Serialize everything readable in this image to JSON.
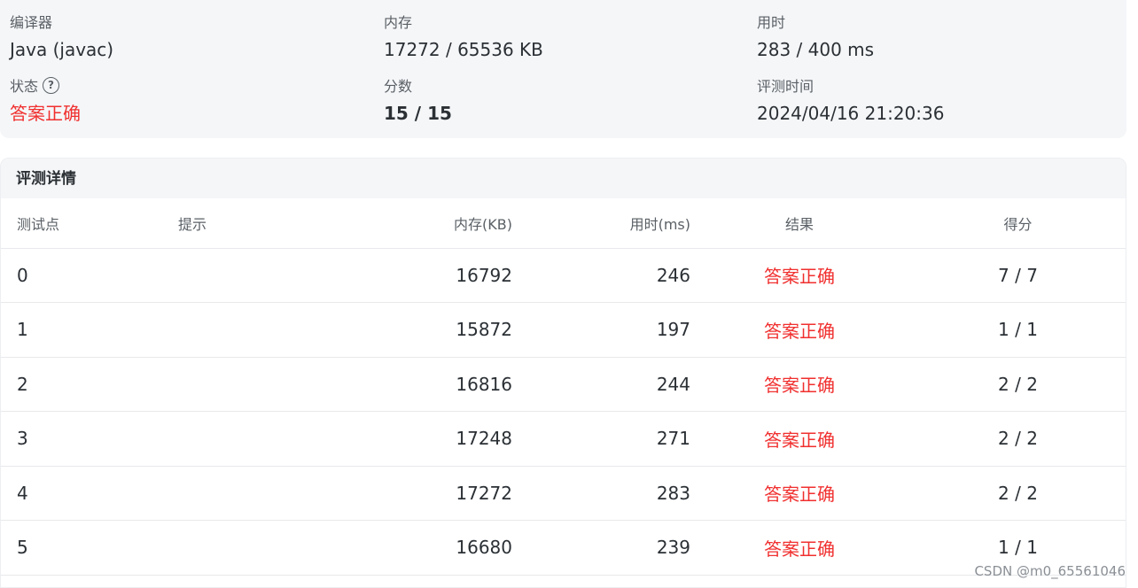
{
  "summary": {
    "compiler_label": "编译器",
    "compiler_value": "Java (javac)",
    "memory_label": "内存",
    "memory_value": "17272 / 65536 KB",
    "time_label": "用时",
    "time_value": "283 / 400 ms",
    "status_label": "状态",
    "status_help_icon": "question-circle-icon",
    "status_help_glyph": "?",
    "status_value": "答案正确",
    "score_label": "分数",
    "score_value": "15 / 15",
    "judge_time_label": "评测时间",
    "judge_time_value": "2024/04/16 21:20:36"
  },
  "detail": {
    "title": "评测详情",
    "columns": {
      "case": "测试点",
      "hint": "提示",
      "memory": "内存(KB)",
      "time": "用时(ms)",
      "result": "结果",
      "score": "得分"
    },
    "rows": [
      {
        "case": "0",
        "hint": "",
        "memory": "16792",
        "time": "246",
        "result": "答案正确",
        "score": "7 / 7"
      },
      {
        "case": "1",
        "hint": "",
        "memory": "15872",
        "time": "197",
        "result": "答案正确",
        "score": "1 / 1"
      },
      {
        "case": "2",
        "hint": "",
        "memory": "16816",
        "time": "244",
        "result": "答案正确",
        "score": "2 / 2"
      },
      {
        "case": "3",
        "hint": "",
        "memory": "17248",
        "time": "271",
        "result": "答案正确",
        "score": "2 / 2"
      },
      {
        "case": "4",
        "hint": "",
        "memory": "17272",
        "time": "283",
        "result": "答案正确",
        "score": "2 / 2"
      },
      {
        "case": "5",
        "hint": "",
        "memory": "16680",
        "time": "239",
        "result": "答案正确",
        "score": "1 / 1"
      }
    ]
  },
  "watermark": "CSDN @m0_65561046",
  "colors": {
    "accepted": "#f0302f",
    "panel_background": "#f5f6f8"
  }
}
